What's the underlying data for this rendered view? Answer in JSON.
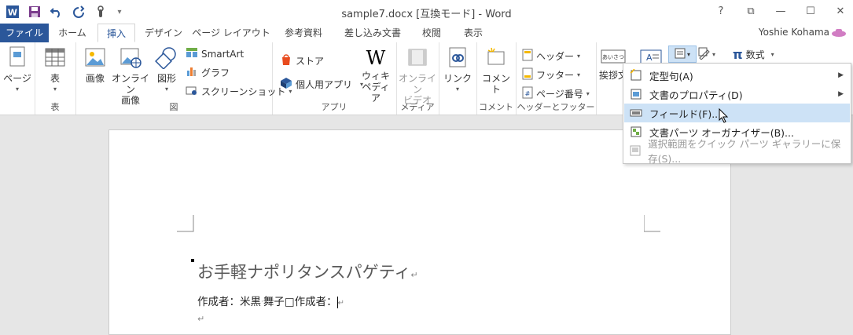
{
  "window": {
    "title": "sample7.docx [互換モード] - Word",
    "help": "?",
    "restore_ribbon": "⧉",
    "minimize": "—",
    "maximize": "☐",
    "close": "✕"
  },
  "qat": {
    "more": "▾"
  },
  "tabs": {
    "file": "ファイル",
    "home": "ホーム",
    "insert": "挿入",
    "design": "デザイン",
    "layout": "ページ レイアウト",
    "references": "参考資料",
    "mailings": "差し込み文書",
    "review": "校閲",
    "view": "表示"
  },
  "user": "Yoshie Kohama",
  "ribbon": {
    "pages": {
      "label": "ページ"
    },
    "tables": {
      "table": "表",
      "group": "表"
    },
    "illustrations": {
      "picture": "画像",
      "online_picture_1": "オンライン",
      "online_picture_2": "画像",
      "shapes": "図形",
      "smartart": "SmartArt",
      "chart": "グラフ",
      "screenshot": "スクリーンショット",
      "group": "図"
    },
    "apps": {
      "store": "ストア",
      "my_apps": "個人用アプリ",
      "wiki_1": "ウィキ",
      "wiki_2": "ペディア",
      "group": "アプリ"
    },
    "media": {
      "video_1": "オンライン",
      "video_2": "ビデオ",
      "group": "メディア"
    },
    "links": {
      "link": "リンク"
    },
    "comments": {
      "comment": "コメント",
      "group": "コメント"
    },
    "header_footer": {
      "header": "ヘッダー",
      "footer": "フッター",
      "page_number": "ページ番号",
      "group": "ヘッダーとフッター"
    },
    "text": {
      "greeting": "挨拶文",
      "greeting_icon_text": "あいさつ"
    },
    "symbols": {
      "equation": "数式"
    }
  },
  "quickparts_menu": {
    "items": [
      {
        "label": "定型句(A)"
      },
      {
        "label": "文書のプロパティ(D)"
      },
      {
        "label": "フィールド(F)..."
      },
      {
        "label": "文書パーツ オーガナイザー(B)..."
      },
      {
        "label": "選択範囲をクイック パーツ ギャラリーに保存(S)..."
      }
    ]
  },
  "document": {
    "title": "お手軽ナポリタンスパゲティ",
    "author_line": "作成者：米黒",
    "author_line_2": "舞子□作成者：",
    "para_mark": "↵"
  },
  "colors": {
    "file_tab": "#2b579a",
    "highlight": "#cde2f6"
  }
}
